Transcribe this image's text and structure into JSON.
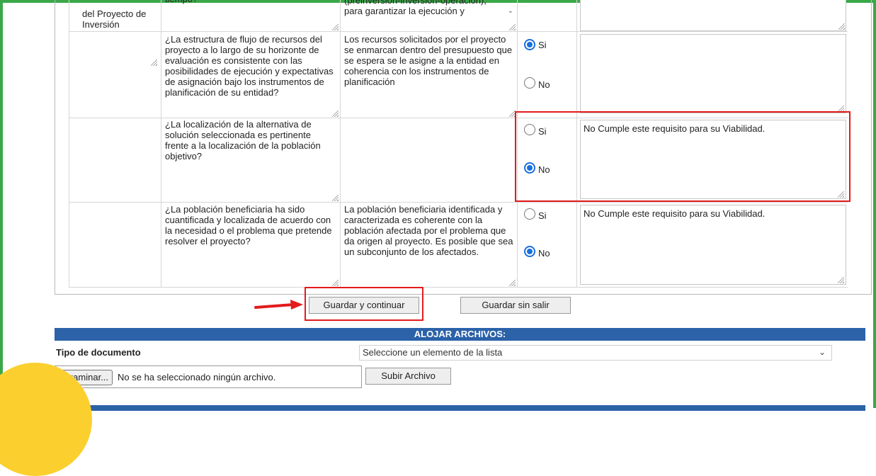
{
  "colors": {
    "accent": "#2b62a8",
    "highlight": "#e31b1b",
    "frame": "#3aa848",
    "circle": "#fbcf2e"
  },
  "stage_label": "del Proyecto de Inversión",
  "row0": {
    "question_tail": "tiempo?",
    "criterion_lines": [
      "(preinversión-inversión-operación),",
      "para garantizar la ejecución y"
    ],
    "observation": ""
  },
  "rows": [
    {
      "question": "¿La estructura de flujo de recursos del proyecto a lo largo de su horizonte de evaluación es consistente con las posibilidades de ejecución y expectativas de asignación bajo los instrumentos de planificación de su entidad?",
      "criterion": "Los recursos solicitados por el proyecto se enmarcan dentro del presupuesto que se espera se le asigne a la entidad en coherencia con los instrumentos de planificación",
      "yes_label": "Si",
      "no_label": "No",
      "selected": "Si",
      "observation": ""
    },
    {
      "question": "¿La localización de la alternativa de solución seleccionada es pertinente frente a la localización de la población objetivo?",
      "criterion": "",
      "yes_label": "Si",
      "no_label": "No",
      "selected": "No",
      "observation": "No Cumple este requisito para su Viabilidad."
    },
    {
      "question": "¿La población beneficiaria ha sido cuantificada y localizada de acuerdo con la necesidad o el problema que pretende resolver el proyecto?",
      "criterion": "La población beneficiaria identificada y caracterizada es coherente con la población afectada por el problema que da origen al proyecto. Es posible que sea un subconjunto de los afectados.",
      "yes_label": "Si",
      "no_label": "No",
      "selected": "No",
      "observation": "No Cumple este requisito para su Viabilidad."
    }
  ],
  "buttons": {
    "save_continue": "Guardar y continuar",
    "save_stay": "Guardar sin salir",
    "upload": "Subir Archivo"
  },
  "upload_section": {
    "title": "ALOJAR ARCHIVOS:",
    "doc_type_label": "Tipo de documento",
    "doc_type_selected": "Seleccione un elemento de la lista",
    "browse_label": "Examinar...",
    "file_status": "No se ha seleccionado ningún archivo."
  }
}
